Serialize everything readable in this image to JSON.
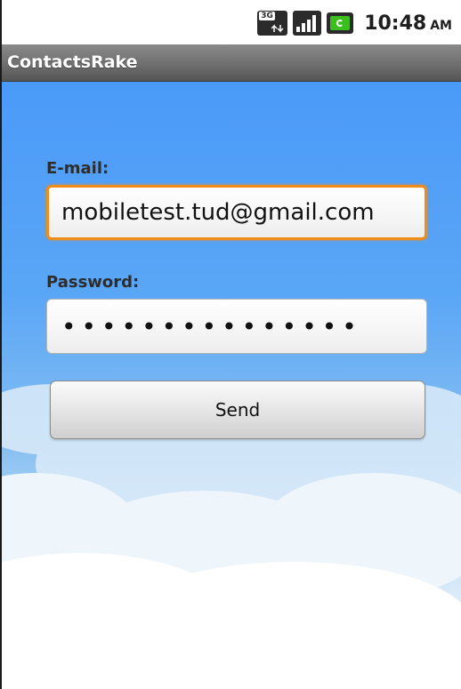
{
  "status_bar": {
    "network_type": "3G",
    "time": "10:48",
    "ampm": "AM",
    "icons": [
      "network-3g-icon",
      "signal-strength-icon",
      "battery-charging-icon"
    ]
  },
  "app": {
    "title": "ContactsRake"
  },
  "form": {
    "email_label": "E-mail:",
    "email_value": "mobiletest.tud@gmail.com",
    "password_label": "Password:",
    "password_masked": "•••••••••••••••",
    "send_label": "Send"
  },
  "colors": {
    "sky_top": "#4a9af8",
    "focus_border": "#f08c1a",
    "title_bar": "#6f6f6f",
    "battery_green": "#3cbf1e"
  }
}
